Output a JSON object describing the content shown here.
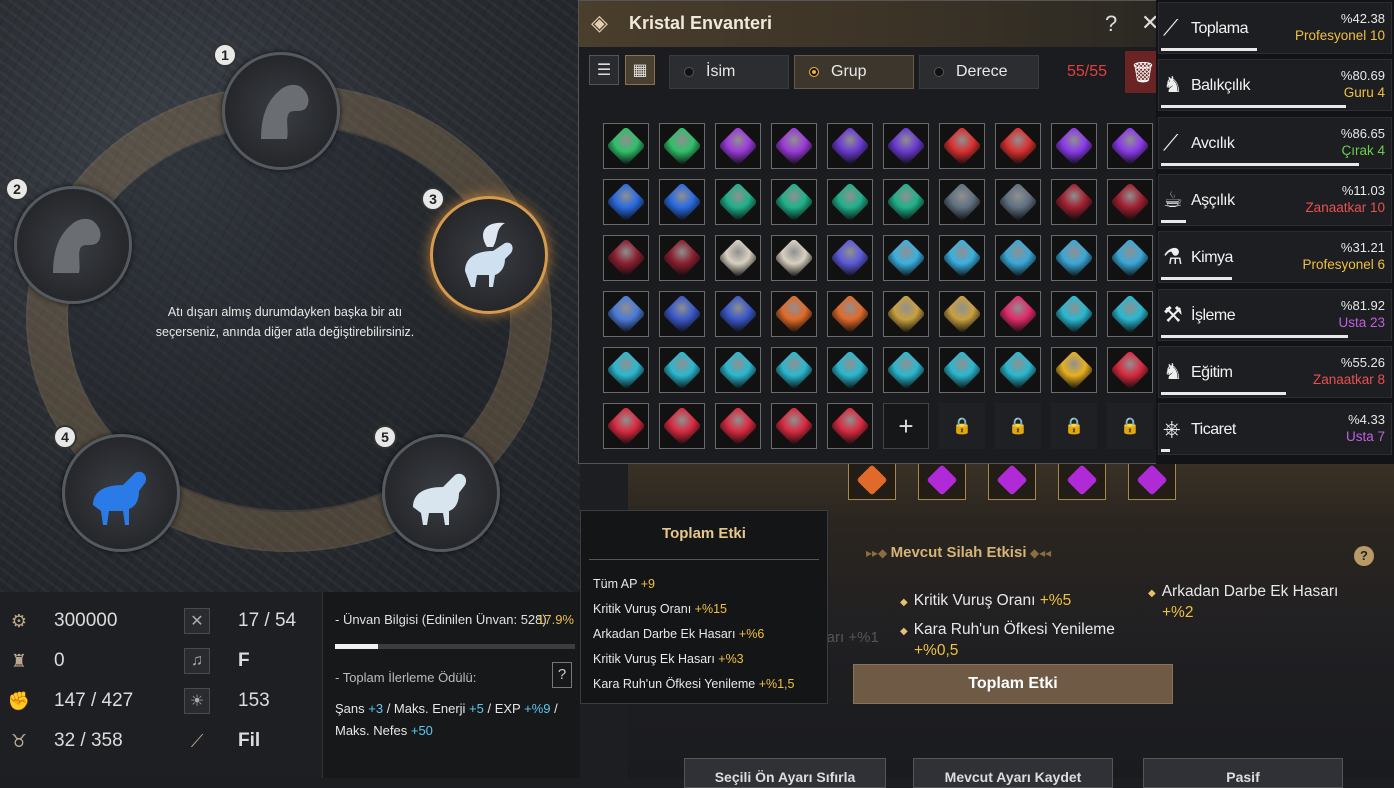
{
  "wheel": {
    "hint": "Atı dışarı almış durumdayken başka bir atı seçerseniz, anında diğer atla değiştirebilirsiniz.",
    "slots": [
      "1",
      "2",
      "3",
      "4",
      "5"
    ]
  },
  "stats": {
    "silver": "300000",
    "fame": "0",
    "weight": "147 / 427",
    "energy": "32 / 358",
    "skill": "17 / 54",
    "music": "F",
    "contribution": "153",
    "mount": "Fil"
  },
  "title_info": {
    "label": "- Ünvan Bilgisi (Edinilen Ünvan: 528)",
    "percent": "17.9%",
    "progress": 0.179,
    "reward_label": "- Toplam İlerleme Ödülü:",
    "help": "?",
    "bonus_a": "Şans ",
    "bonus_a_val": "+3",
    "bonus_b": " / Maks. Enerji ",
    "bonus_b_val": "+5",
    "bonus_c": " / EXP ",
    "bonus_c_val": "+%9",
    "bonus_d": " / Maks. Nefes ",
    "bonus_d_val": "+50"
  },
  "inventory": {
    "title": "Kristal Envanteri",
    "help": "?",
    "close": "✕",
    "sort": [
      "İsim",
      "Grup",
      "Derece"
    ],
    "count": "55/55",
    "add": "+",
    "gem_colors": [
      [
        "#2fbf6a",
        "#2fbf6a",
        "#9a3ad8",
        "#9a3ad8",
        "#6a3ad0",
        "#6a3ad0",
        "#d93030",
        "#d93030",
        "#8a3ae8",
        "#8a3ae8"
      ],
      [
        "#2a6ae0",
        "#2a6ae0",
        "#1fb08a",
        "#1fb08a",
        "#1fb08a",
        "#1fb08a",
        "#607080",
        "#607080",
        "#a02030",
        "#a02030"
      ],
      [
        "#8a2030",
        "#8a2030",
        "#d8d0c0",
        "#d8d0c0",
        "#5a5ad8",
        "#3ab0e0",
        "#3ab0e0",
        "#3aa8d8",
        "#3aa8d8",
        "#3aa8d8"
      ],
      [
        "#4a7ad8",
        "#3a58c8",
        "#3a58c8",
        "#e06a2a",
        "#e06a2a",
        "#c8a040",
        "#c8a040",
        "#e02a6a",
        "#2ab8d0",
        "#2ab8d0"
      ],
      [
        "#2ab8d0",
        "#2ab8d0",
        "#2ab8d0",
        "#2ab8d0",
        "#2ab8d0",
        "#2ab8d0",
        "#2ab8d0",
        "#2ab8d0",
        "#e8b020",
        "#d82a40"
      ],
      [
        "#d82a40",
        "#d82a40",
        "#d82a40",
        "#d82a40",
        "#d82a40"
      ]
    ]
  },
  "life_skills": [
    {
      "name": "Toplama",
      "pct": "%42.38",
      "level": "Profesyonel 10",
      "color": "#f0c040",
      "progress": 0.42,
      "icon": "⟋"
    },
    {
      "name": "Balıkçılık",
      "pct": "%80.69",
      "level": "Guru 4",
      "color": "#f0c040",
      "progress": 0.81,
      "icon": "♞"
    },
    {
      "name": "Avcılık",
      "pct": "%86.65",
      "level": "Çırak 4",
      "color": "#6ad04a",
      "progress": 0.87,
      "icon": "⟋"
    },
    {
      "name": "Aşçılık",
      "pct": "%11.03",
      "level": "Zanaatkar 10",
      "color": "#e85050",
      "progress": 0.11,
      "icon": "☕"
    },
    {
      "name": "Kimya",
      "pct": "%31.21",
      "level": "Profesyonel 6",
      "color": "#f0c040",
      "progress": 0.31,
      "icon": "⚗"
    },
    {
      "name": "İşleme",
      "pct": "%81.92",
      "level": "Usta 23",
      "color": "#c060e0",
      "progress": 0.82,
      "icon": "⚒"
    },
    {
      "name": "Eğitim",
      "pct": "%55.26",
      "level": "Zanaatkar 8",
      "color": "#e85050",
      "progress": 0.55,
      "icon": "♞"
    },
    {
      "name": "Ticaret",
      "pct": "%4.33",
      "level": "Usta 7",
      "color": "#c060e0",
      "progress": 0.04,
      "icon": "⎈"
    }
  ],
  "total_tip": {
    "title": "Toplam Etki",
    "lines": [
      {
        "label": "Tüm AP ",
        "val": "+9"
      },
      {
        "label": "Kritik Vuruş Oranı ",
        "val": "+%15"
      },
      {
        "label": "Arkadan Darbe Ek Hasarı ",
        "val": "+%6"
      },
      {
        "label": "Kritik Vuruş Ek Hasarı ",
        "val": "+%3"
      },
      {
        "label": "Kara Ruh'un Öfkesi Yenileme ",
        "val": "+%1,5"
      }
    ]
  },
  "weapon_effect": {
    "title": "Mevcut Silah Etkisi",
    "help": "?",
    "e1": "Kritik Vuruş Oranı ",
    "e1v": "+%5",
    "e2": "Arkadan Darbe Ek Hasarı",
    "e2v": "+%2",
    "e3": "Kara Ruh'un Öfkesi Yenileme",
    "e3v": "+%0,5",
    "partial": "Hasarı +%1",
    "total_button": "Toplam Etki",
    "btn_reset": "Seçili Ön Ayarı Sıfırla",
    "btn_save": "Mevcut Ayarı Kaydet",
    "btn_passive": "Pasif"
  }
}
